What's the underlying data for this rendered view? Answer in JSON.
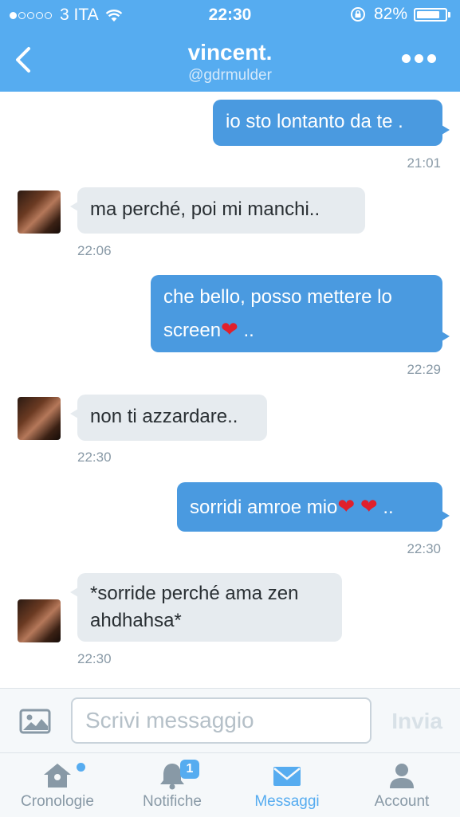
{
  "status_bar": {
    "carrier": "3 ITA",
    "time": "22:30",
    "battery": "82%",
    "battery_level": 0.82
  },
  "header": {
    "name": "vincent.",
    "handle": "@gdrmulder"
  },
  "messages": [
    {
      "text": "io sto lontanto da te .",
      "time": "21:01",
      "direction": "outgoing"
    },
    {
      "text": "ma perché, poi mi manchi..",
      "time": "22:06",
      "direction": "incoming"
    },
    {
      "text_a": "che bello, posso mettere lo",
      "text_b": "screen",
      "text_c": " ..",
      "time": "22:29",
      "direction": "outgoing"
    },
    {
      "text": "non ti azzardare..",
      "time": "22:30",
      "direction": "incoming"
    },
    {
      "text": "sorridi amroe mio",
      "text_end": " ..",
      "time": "22:30",
      "direction": "outgoing"
    },
    {
      "text": "*sorride perché ama zen ahdhahsa*",
      "time": "22:30",
      "direction": "incoming"
    }
  ],
  "compose": {
    "placeholder": "Scrivi messaggio",
    "send_label": "Invia"
  },
  "tabs": [
    {
      "label": "Cronologie",
      "icon": "home-icon"
    },
    {
      "label": "Notifiche",
      "icon": "bell-icon",
      "badge": "1"
    },
    {
      "label": "Messaggi",
      "icon": "envelope-icon",
      "active": true
    },
    {
      "label": "Account",
      "icon": "person-icon"
    }
  ],
  "colors": {
    "accent": "#56acf0",
    "outgoing_bubble": "#4a9ae0",
    "incoming_bubble": "#e6ebef",
    "heart": "#e0202c"
  }
}
